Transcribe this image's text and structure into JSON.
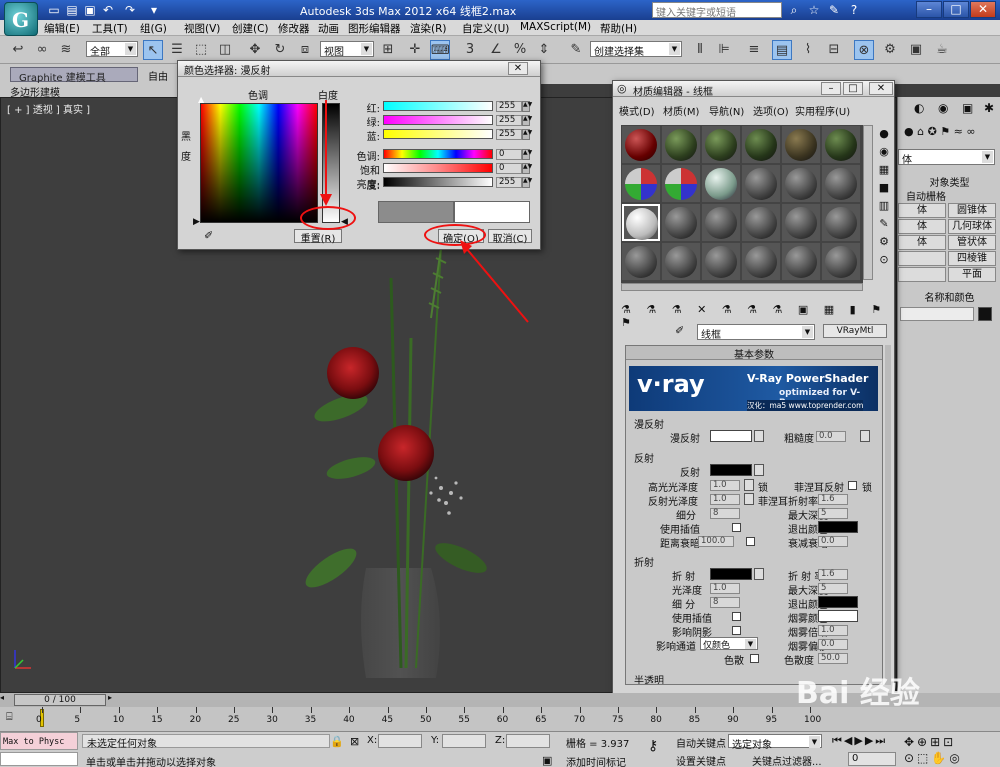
{
  "app": {
    "title": "Autodesk 3ds Max  2012 x64     线框2.max",
    "search_placeholder": "键入关键字或短语"
  },
  "menu": [
    "编辑(E)",
    "工具(T)",
    "组(G)",
    "视图(V)",
    "创建(C)",
    "修改器",
    "动画",
    "图形编辑器",
    "渲染(R)",
    "自定义(U)",
    "MAXScript(M)",
    "帮助(H)"
  ],
  "toolbar": {
    "selection_filter": "全部",
    "ref_coord": "视图",
    "named_selection": "创建选择集"
  },
  "ribbon": {
    "tab_graphite": "Graphite 建模工具",
    "tab_freeform": "自由",
    "sub_label": "多边形建模"
  },
  "viewport": {
    "label": "[ + ] 透视 ] 真实 ]"
  },
  "color_picker": {
    "title": "颜色选择器: 漫反射",
    "hue_label": "色调",
    "whiteness_label": "白度",
    "blackness_label": "黑\n\n度",
    "channels": [
      {
        "label": "红:",
        "value": "255"
      },
      {
        "label": "绿:",
        "value": "255"
      },
      {
        "label": "蓝:",
        "value": "255"
      },
      {
        "label": "色调:",
        "value": "0"
      },
      {
        "label": "饱和度:",
        "value": "0"
      },
      {
        "label": "亮度:",
        "value": "255"
      }
    ],
    "reset_label": "重置(R)",
    "ok_label": "确定(O)",
    "cancel_label": "取消(C)"
  },
  "material_editor": {
    "title": "材质编辑器 - 线框",
    "menu": [
      "模式(D)",
      "材质(M)",
      "导航(N)",
      "选项(O)",
      "实用程序(U)"
    ],
    "material_name": "线框",
    "material_type": "VRayMtl",
    "rollout_basic": "基本参数",
    "vray_banner_title": "V-Ray PowerShader",
    "vray_banner_sub": "optimized for V-Ray",
    "vray_banner_credit": "汉化：ma5 www.toprender.com",
    "vray_logo": "v·ray",
    "diffuse_group": "漫反射",
    "diffuse_label": "漫反射",
    "roughness_label": "粗糙度",
    "roughness_value": "0.0",
    "reflect_group": "反射",
    "reflect_label": "反射",
    "hilight_gloss_label": "高光光泽度",
    "hilight_gloss_value": "1.0",
    "lock_label": "锁",
    "fresnel_label": "菲涅耳反射",
    "refl_gloss_label": "反射光泽度",
    "refl_gloss_value": "1.0",
    "fresnel_ior_label": "菲涅耳折射率",
    "fresnel_ior_value": "1.6",
    "subdivs_label": "细分",
    "subdivs_value": "8",
    "max_depth_label": "最大深度",
    "max_depth_value": "5",
    "use_interp_label": "使用插值",
    "exit_color_label": "退出颜色",
    "dim_dist_label": "距离衰暗",
    "dim_dist_value": "100.0",
    "dim_falloff_label": "衰减衰暗",
    "dim_falloff_value": "0.0",
    "refract_group": "折射",
    "refract_label": "折 射",
    "ior_label": "折 射 率",
    "ior_value": "1.6",
    "gloss_label": "光泽度",
    "gloss_value": "1.0",
    "rf_max_depth_label": "最大深度",
    "rf_max_depth_value": "5",
    "rf_subdivs_label": "细 分",
    "rf_subdivs_value": "8",
    "rf_exit_label": "退出颜色",
    "rf_interp_label": "使用插值",
    "fog_color_label": "烟雾颜色",
    "shadows_label": "影响阴影",
    "fog_mult_label": "烟雾倍增",
    "fog_mult_value": "1.0",
    "affect_ch_label": "影响通道",
    "affect_ch_value": "仅颜色",
    "fog_bias_label": "烟雾偏移",
    "fog_bias_value": "0.0",
    "dispersion_label": "色散",
    "abbe_label": "色散度",
    "abbe_value": "50.0",
    "translucent_group": "半透明"
  },
  "command_panel": {
    "dropdown": "体",
    "object_type": "对象类型",
    "autogrid": "自动栅格",
    "buttons": [
      "体",
      "圆锥体",
      "体",
      "几何球体",
      "体",
      "管状体",
      "",
      "四棱锥",
      "",
      "平面"
    ],
    "name_color": "名称和颜色"
  },
  "timeline": {
    "frame": "0 / 100",
    "ticks": [
      "0",
      "5",
      "10",
      "15",
      "20",
      "25",
      "30",
      "35",
      "40",
      "45",
      "50",
      "55",
      "60",
      "65",
      "70",
      "75",
      "80",
      "85",
      "90",
      "95",
      "100"
    ]
  },
  "status": {
    "script_box": "Max to Physc",
    "no_selection": "未选定任何对象",
    "prompt": "单击或单击并拖动以选择对象",
    "x_label": "X:",
    "y_label": "Y:",
    "z_label": "Z:",
    "grid": "栅格 = 3.937",
    "add_time_tag": "添加时间标记",
    "auto_key": "自动关键点",
    "selected_object": "选定对象",
    "set_key": "设置关键点",
    "key_filters": "关键点过滤器...",
    "frame_value": "0"
  },
  "watermark": "Bai 经验"
}
